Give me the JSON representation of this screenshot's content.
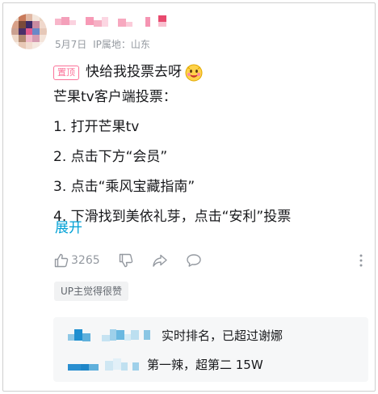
{
  "comment": {
    "date": "5月7日",
    "ip_location": "IP属地：山东",
    "pin_label": "置顶",
    "headline": "快给我投票去呀",
    "body_lines": [
      "芒果tv客户端投票：",
      "1. 打开芒果tv",
      "2. 点击下方“会员”",
      "3. 点击“乘风宝藏指南”",
      "4. 下滑找到美依礼芽，点击“安利”投票"
    ],
    "expand_label": "展开",
    "like_count": "3265",
    "up_badge": "UP主觉得很赞"
  },
  "replies": [
    {
      "text": "实时排名，已超过谢娜"
    },
    {
      "text": "第一辣，超第二 15W"
    }
  ],
  "icons": {
    "like": "thumb-up-icon",
    "dislike": "thumb-down-icon",
    "share": "share-icon",
    "reply": "comment-icon",
    "more": "more-vertical-icon",
    "emoji": "smiling-face-emoji"
  },
  "colors": {
    "accent_blue": "#00a1d6",
    "pin_pink": "#fb7299",
    "muted": "#9499a0"
  }
}
